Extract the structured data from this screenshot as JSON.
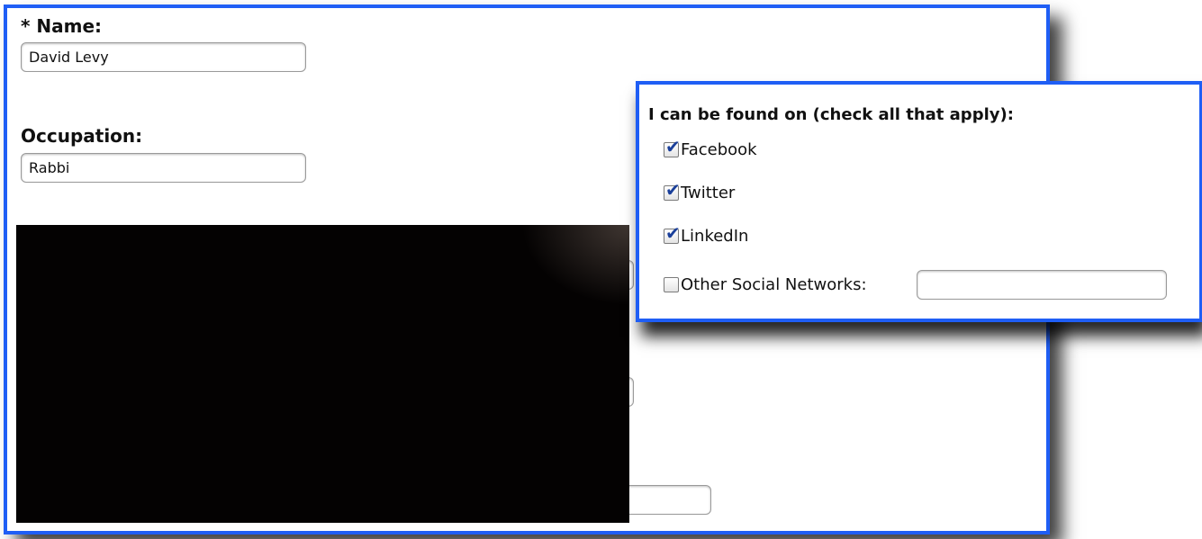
{
  "form": {
    "name_label": "* Name:",
    "name_value": "David Levy",
    "occupation_label": "Occupation:",
    "occupation_value": "Rabbi"
  },
  "social": {
    "title": "I can be found on (check all that apply):",
    "options": [
      {
        "label": "Facebook",
        "checked": true
      },
      {
        "label": "Twitter",
        "checked": true
      },
      {
        "label": "LinkedIn",
        "checked": true
      },
      {
        "label": "Other Social Networks:",
        "checked": false
      }
    ],
    "other_value": ""
  },
  "icons": {
    "checked": "checkmark-icon"
  },
  "colors": {
    "frame_border": "#1f5ef5",
    "redaction": "#040202",
    "checkmark": "#1a3f9a"
  }
}
